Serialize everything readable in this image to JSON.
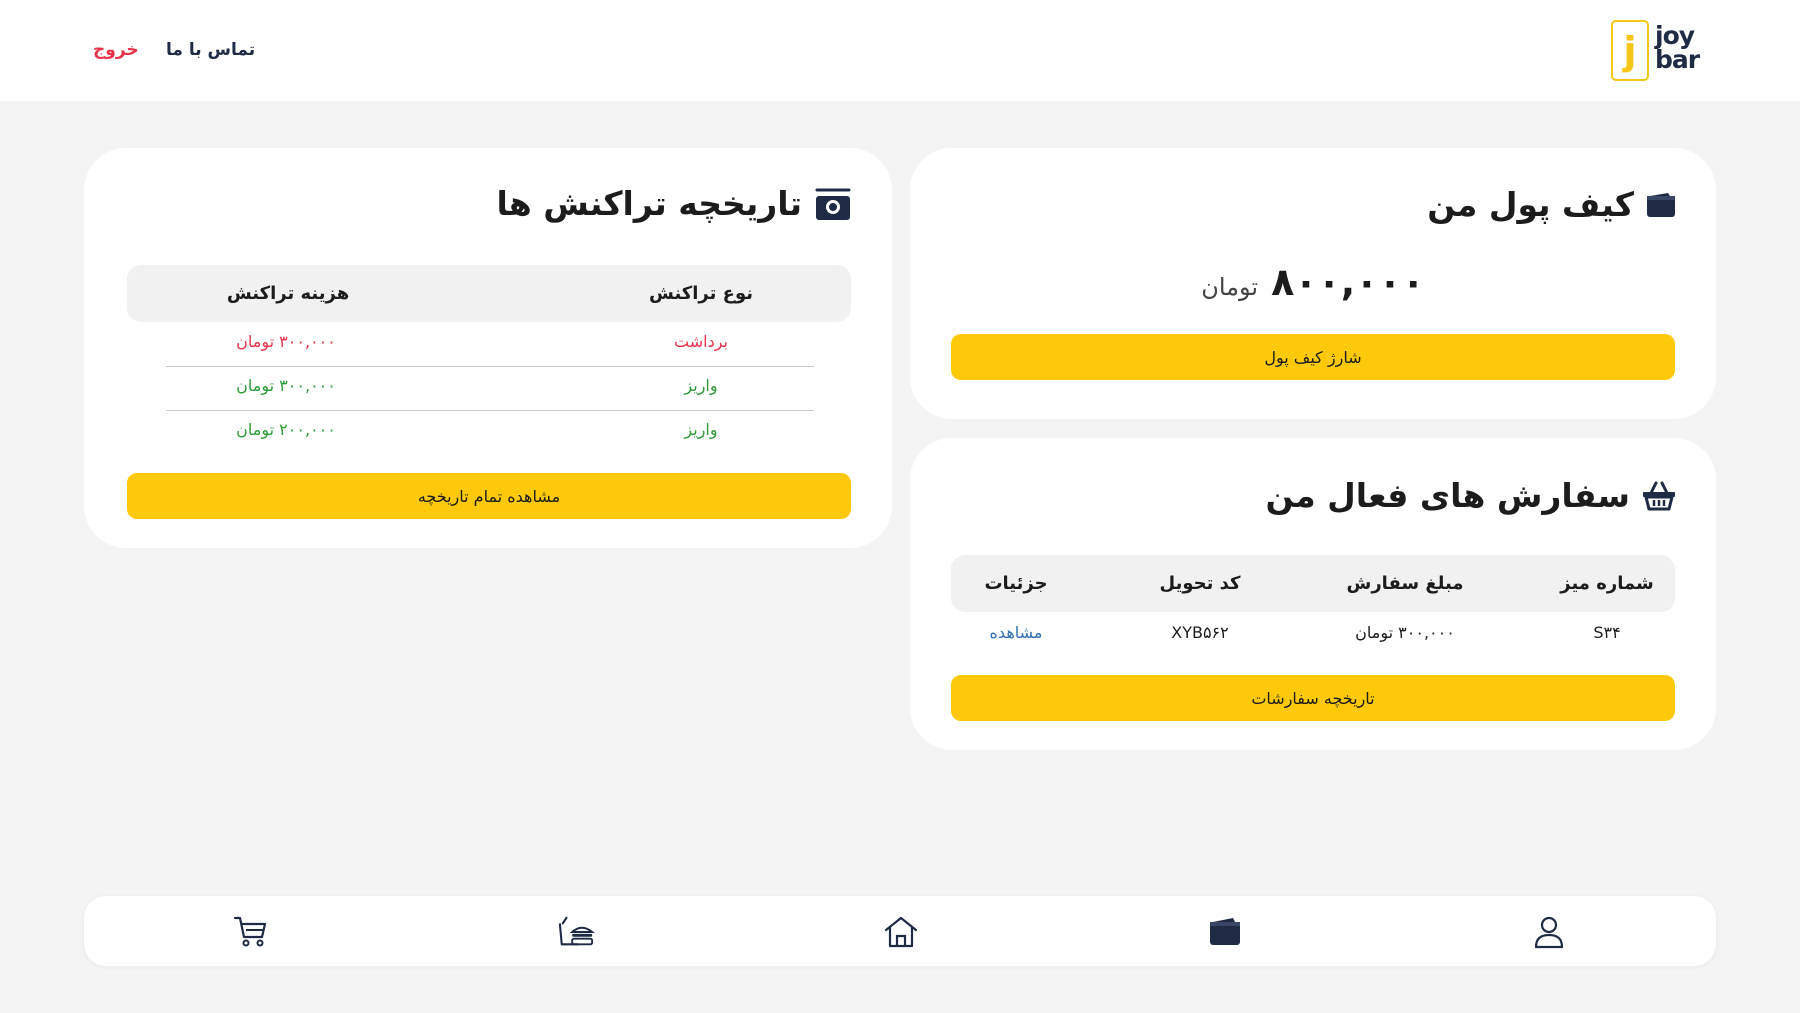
{
  "header": {
    "logo": {
      "letter": "j",
      "line1": "joy",
      "line2": "bar"
    },
    "contact_label": "تماس با ما",
    "logout_label": "خروج"
  },
  "colors": {
    "accent": "#fdc909",
    "danger": "#e8334a",
    "success": "#2e9b3a",
    "link": "#2f6fb0",
    "navy": "#1f2a44"
  },
  "wallet": {
    "icon": "wallet-icon",
    "title": "کیف پول من",
    "balance": "۸۰۰,۰۰۰",
    "unit": "تومان",
    "charge_label": "شارژ کیف پول"
  },
  "orders": {
    "icon": "basket-icon",
    "title": "سفارش های فعال من",
    "columns": [
      "شماره میز",
      "مبلغ سفارش",
      "کد تحویل",
      "جزئیات"
    ],
    "rows": [
      {
        "table": "S۳۴",
        "amount": "۳۰۰,۰۰۰ تومان",
        "code": "XYB۵۶۲",
        "details": "مشاهده"
      }
    ],
    "history_label": "تاریخچه سفارشات"
  },
  "transactions": {
    "icon": "camera-icon",
    "title": "تاریخچه تراکنش ها",
    "columns": [
      "نوع تراکنش",
      "هزینه تراکنش"
    ],
    "rows": [
      {
        "type": "برداشت",
        "cost": "۳۰۰,۰۰۰ تومان",
        "status": "withdraw"
      },
      {
        "type": "واریز",
        "cost": "۳۰۰,۰۰۰ تومان",
        "status": "deposit"
      },
      {
        "type": "واریز",
        "cost": "۲۰۰,۰۰۰ تومان",
        "status": "deposit"
      }
    ],
    "view_all_label": "مشاهده تمام تاریخچه"
  },
  "bottom_nav": {
    "items": [
      "cart-icon",
      "food-menu-icon",
      "home-icon",
      "wallet-icon",
      "profile-icon"
    ],
    "active": "wallet-icon"
  }
}
